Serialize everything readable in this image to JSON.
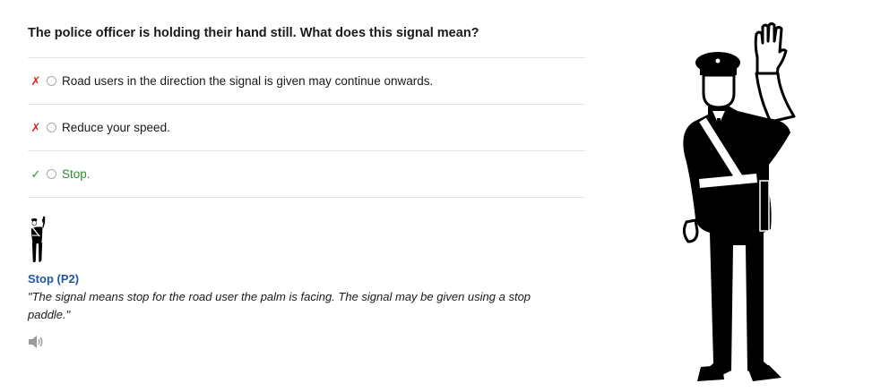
{
  "question": {
    "text": "The police officer is holding their hand still. What does this signal mean?"
  },
  "answers": [
    {
      "mark_icon": "cross-icon",
      "mark": "✗",
      "text": "Road users in the direction the signal is given may continue onwards.",
      "status": "wrong"
    },
    {
      "mark_icon": "cross-icon",
      "mark": "✗",
      "text": "Reduce your speed.",
      "status": "wrong"
    },
    {
      "mark_icon": "check-icon",
      "mark": "✓",
      "text": "Stop.",
      "status": "correct"
    }
  ],
  "explanation": {
    "title": "Stop (P2)",
    "quote": "\"The signal means stop for the road user the palm is facing. The signal may be given using a stop paddle.\"",
    "audio_icon": "speaker-icon"
  },
  "colors": {
    "wrong": "#d22a2a",
    "correct": "#2e8b2e",
    "link": "#1f56a8",
    "divider": "#e4e4e4"
  }
}
